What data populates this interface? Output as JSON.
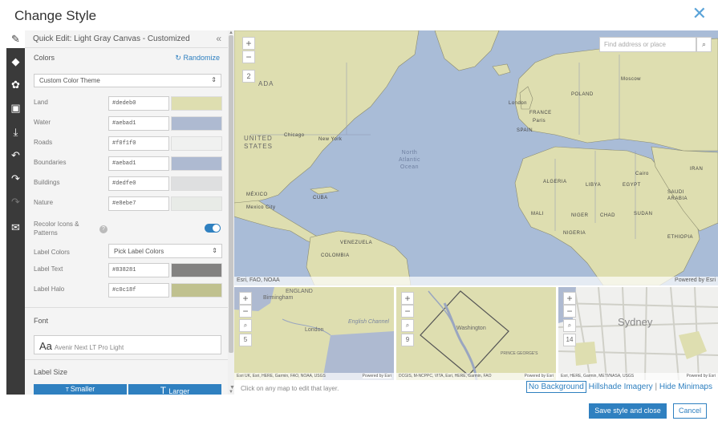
{
  "dialog": {
    "title": "Change Style",
    "close_icon": "close-icon"
  },
  "toolbar": {
    "items": [
      {
        "icon": "pencil-icon"
      },
      {
        "icon": "layers-icon"
      },
      {
        "icon": "palette-icon"
      },
      {
        "icon": "images-icon"
      },
      {
        "icon": "download-icon"
      },
      {
        "icon": "undo-icon"
      },
      {
        "icon": "redo-icon"
      },
      {
        "icon": "redo-disabled-icon"
      },
      {
        "icon": "mail-icon"
      }
    ]
  },
  "panel": {
    "header": "Quick Edit: Light Gray Canvas - Customized",
    "collapse": "«",
    "colors_title": "Colors",
    "randomize": "Randomize",
    "theme": "Custom Color Theme",
    "color_rows": [
      {
        "label": "Land",
        "hex": "#dedeb0",
        "color": "#dedeb0"
      },
      {
        "label": "Water",
        "hex": "#aebad1",
        "color": "#aebad1"
      },
      {
        "label": "Roads",
        "hex": "#f0f1f0",
        "color": "#f0f1f0"
      },
      {
        "label": "Boundaries",
        "hex": "#aebad1",
        "color": "#aebad1"
      },
      {
        "label": "Buildings",
        "hex": "#dedfe0",
        "color": "#dedfe0"
      },
      {
        "label": "Nature",
        "hex": "#e8ebe7",
        "color": "#e8ebe7"
      }
    ],
    "recolor_label": "Recolor Icons & Patterns",
    "recolor_on": true,
    "label_colors_label": "Label Colors",
    "label_colors_value": "Pick Label Colors",
    "label_rows": [
      {
        "label": "Label Text",
        "hex": "#838281",
        "color": "#838281"
      },
      {
        "label": "Label Halo",
        "hex": "#c0c18f",
        "color": "#c0c18f"
      }
    ],
    "font_title": "Font",
    "font_sample": "Aa",
    "font_name": "Avenir Next LT Pro Light",
    "label_size_title": "Label Size",
    "smaller": "Smaller",
    "larger": "Larger"
  },
  "map": {
    "zoom_in": "+",
    "zoom_out": "−",
    "level": "2",
    "search_placeholder": "Find address or place",
    "attribution": "Esri, FAO, NOAA",
    "powered": "Powered by Esri",
    "labels": {
      "canada": "ADA",
      "us": "UNITED\nSTATES",
      "ocean": "North\nAtlantic\nOcean",
      "mexico": "MÉXICO",
      "mexico_city": "Mexico City",
      "chicago": "Chicago",
      "new_york": "New York",
      "moscow": "Moscow",
      "poland": "POLAND",
      "france": "FRANCE",
      "spain": "SPAIN",
      "algeria": "ALGERIA",
      "libya": "LIBYA",
      "egypt": "EGYPT",
      "mali": "MALI",
      "niger": "NIGER",
      "chad": "CHAD",
      "sudan": "SUDAN",
      "nigeria": "NIGERIA",
      "ethiopia": "ETHIOPIA",
      "venezuela": "VENEZUELA",
      "colombia": "COLOMBIA",
      "cairo": "Cairo",
      "iran": "IRAN",
      "saudi": "SAUDI\nARABIA",
      "london": "London",
      "paris": "Paris",
      "cuba": "CUBA"
    }
  },
  "minimaps": [
    {
      "level": "5",
      "attribution": "Esri UK, Esri, HERE, Garmin, FAO, NOAA, USGS",
      "powered": "Powered by Esri",
      "labels": [
        "ENGLAND",
        "Birmingham",
        "London",
        "English Channel"
      ]
    },
    {
      "level": "9",
      "attribution": "DCGIS, M-NCPPC, VITA, Esri, HERE, Garmin, FAO",
      "powered": "Powered by Esri",
      "labels": [
        "Washington",
        "PRINCE GEORGE'S"
      ]
    },
    {
      "level": "14",
      "attribution": "Esri, HERE, Garmin, METI/NASA, USGS",
      "powered": "Powered by Esri",
      "labels": [
        "Sydney"
      ]
    }
  ],
  "footer": {
    "hint": "Click on any map to edit that layer.",
    "no_background": "No Background",
    "hillshade": "Hillshade",
    "imagery": "Imagery",
    "hide_minimaps": "Hide Minimaps",
    "divider": "|",
    "save": "Save style and close",
    "cancel": "Cancel"
  }
}
